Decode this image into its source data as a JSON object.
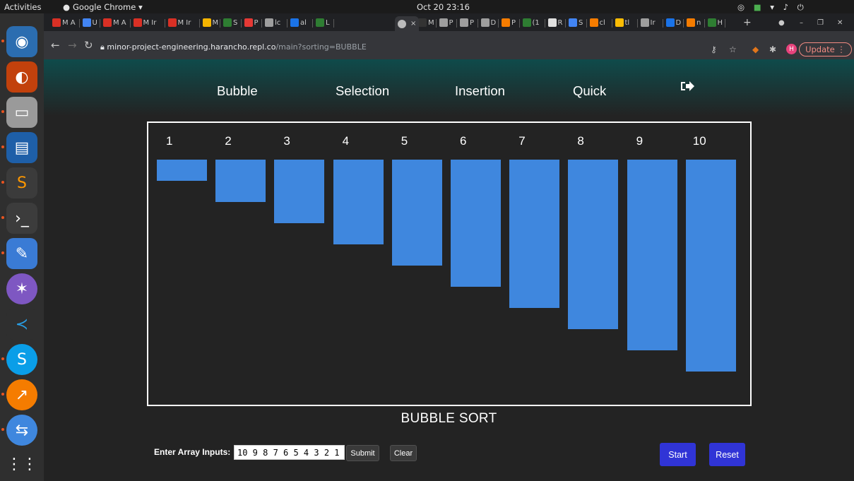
{
  "system_bar": {
    "activities": "Activities",
    "app_menu": "Google Chrome ▾",
    "clock": "Oct 20  23:16"
  },
  "browser": {
    "active_tab_close": "×",
    "new_tab": "+",
    "url_host": "minor-project-engineering.harancho.repl.co",
    "url_path": "/main?sorting=BUBBLE",
    "update_label": "Update",
    "avatar_letter": "H",
    "tabs": [
      "M A",
      "U",
      "M A",
      "M Ir",
      "M Ir",
      "M",
      "S",
      "P",
      "lc",
      "al",
      "L",
      "M",
      "P",
      "P",
      "D",
      "P",
      "(1",
      "R",
      "S",
      "cl",
      "tl",
      "Ir",
      "D",
      "n",
      "H"
    ]
  },
  "navbar": {
    "links": [
      "Bubble",
      "Selection",
      "Insertion",
      "Quick"
    ],
    "logout_icon": "sign-out-icon"
  },
  "visualizer": {
    "bar_color": "#3f87de",
    "labels": [
      "1",
      "2",
      "3",
      "4",
      "5",
      "6",
      "7",
      "8",
      "9",
      "10"
    ],
    "values": [
      1,
      2,
      3,
      4,
      5,
      6,
      7,
      8,
      9,
      10
    ],
    "max_value": 10
  },
  "algorithm_title": "BUBBLE SORT",
  "controls": {
    "input_label": "Enter Array Inputs:",
    "input_value": "10 9 8 7 6 5 4 3 2 1",
    "submit_label": "Submit",
    "clear_label": "Clear",
    "start_label": "Start",
    "reset_label": "Reset",
    "accent_color": "#3034d6"
  }
}
